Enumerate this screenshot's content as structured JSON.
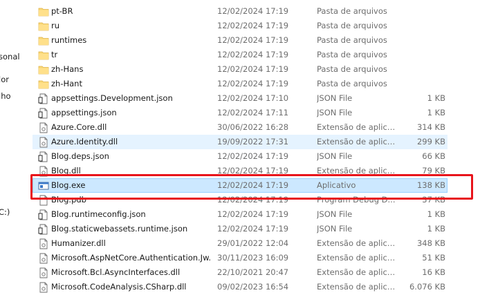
{
  "nav_fragments": [
    "sonal",
    "lor",
    "lho",
    "C:)"
  ],
  "rows": [
    {
      "name": "pt-BR",
      "date": "12/02/2024 17:19",
      "type": "Pasta de arquivos",
      "size": "",
      "icon": "folder-icon"
    },
    {
      "name": "ru",
      "date": "12/02/2024 17:19",
      "type": "Pasta de arquivos",
      "size": "",
      "icon": "folder-icon"
    },
    {
      "name": "runtimes",
      "date": "12/02/2024 17:19",
      "type": "Pasta de arquivos",
      "size": "",
      "icon": "folder-icon"
    },
    {
      "name": "tr",
      "date": "12/02/2024 17:19",
      "type": "Pasta de arquivos",
      "size": "",
      "icon": "folder-icon"
    },
    {
      "name": "zh-Hans",
      "date": "12/02/2024 17:19",
      "type": "Pasta de arquivos",
      "size": "",
      "icon": "folder-icon"
    },
    {
      "name": "zh-Hant",
      "date": "12/02/2024 17:19",
      "type": "Pasta de arquivos",
      "size": "",
      "icon": "folder-icon"
    },
    {
      "name": "appsettings.Development.json",
      "date": "12/02/2024 17:10",
      "type": "JSON File",
      "size": "1 KB",
      "icon": "json-file-icon"
    },
    {
      "name": "appsettings.json",
      "date": "12/02/2024 17:11",
      "type": "JSON File",
      "size": "1 KB",
      "icon": "json-file-icon"
    },
    {
      "name": "Azure.Core.dll",
      "date": "30/06/2022 16:28",
      "type": "Extensão de aplica...",
      "size": "314 KB",
      "icon": "dll-file-icon"
    },
    {
      "name": "Azure.Identity.dll",
      "date": "19/09/2022 17:31",
      "type": "Extensão de aplica...",
      "size": "299 KB",
      "icon": "dll-file-icon"
    },
    {
      "name": "Blog.deps.json",
      "date": "12/02/2024 17:19",
      "type": "JSON File",
      "size": "66 KB",
      "icon": "json-file-icon"
    },
    {
      "name": "Blog.dll",
      "date": "12/02/2024 17:19",
      "type": "Extensão de aplica...",
      "size": "79 KB",
      "icon": "dll-file-icon"
    },
    {
      "name": "Blog.exe",
      "date": "12/02/2024 17:19",
      "type": "Aplicativo",
      "size": "138 KB",
      "icon": "exe-file-icon"
    },
    {
      "name": "Blog.pdb",
      "date": "12/02/2024 17:19",
      "type": "Program Debug D...",
      "size": "37 KB",
      "icon": "file-icon"
    },
    {
      "name": "Blog.runtimeconfig.json",
      "date": "12/02/2024 17:19",
      "type": "JSON File",
      "size": "1 KB",
      "icon": "json-file-icon"
    },
    {
      "name": "Blog.staticwebassets.runtime.json",
      "date": "12/02/2024 17:19",
      "type": "JSON File",
      "size": "1 KB",
      "icon": "json-file-icon"
    },
    {
      "name": "Humanizer.dll",
      "date": "29/01/2022 12:04",
      "type": "Extensão de aplica...",
      "size": "348 KB",
      "icon": "dll-file-icon"
    },
    {
      "name": "Microsoft.AspNetCore.Authentication.Jw...",
      "date": "30/11/2023 16:09",
      "type": "Extensão de aplica...",
      "size": "51 KB",
      "icon": "dll-file-icon"
    },
    {
      "name": "Microsoft.Bcl.AsyncInterfaces.dll",
      "date": "22/10/2021 20:47",
      "type": "Extensão de aplica...",
      "size": "16 KB",
      "icon": "dll-file-icon"
    },
    {
      "name": "Microsoft.CodeAnalysis.CSharp.dll",
      "date": "09/02/2023 16:54",
      "type": "Extensão de aplica...",
      "size": "6.076 KB",
      "icon": "dll-file-icon"
    }
  ],
  "selected_row": "Blog.exe",
  "hover_row": "Azure.Identity.dll",
  "highlight_color": "#e8141b",
  "selection_color": "#cce8ff"
}
